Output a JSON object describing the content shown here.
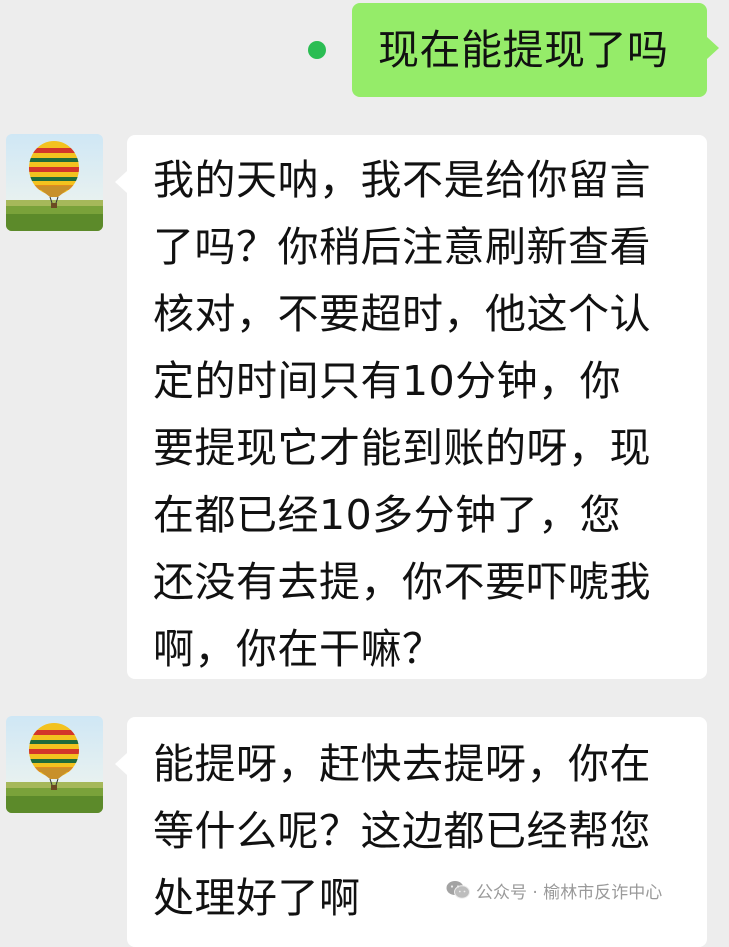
{
  "conversation": {
    "outgoing": {
      "text": "现在能提现了吗",
      "bubble_color": "#95ec69",
      "status_dot_color": "#2bbd53"
    },
    "incoming": [
      {
        "avatar": "hot-air-balloon-avatar",
        "lines": [
          "我的天呐，我不是给你留言",
          "了吗？你稍后注意刷新查看",
          "核对，不要超时，他这个认",
          "定的时间只有10分钟，你",
          "要提现它才能到账的呀，现",
          "在都已经10多分钟了，您",
          "还没有去提，你不要吓唬我",
          "啊，你在干嘛？"
        ]
      },
      {
        "avatar": "hot-air-balloon-avatar",
        "lines": [
          "能提呀，赶快去提呀，你在",
          "等什么呢？这边都已经帮您",
          "处理好了啊"
        ]
      }
    ]
  },
  "watermark": {
    "text": "公众号 · 榆林市反诈中心",
    "icon": "wechat-icon"
  },
  "colors": {
    "background": "#ededed",
    "incoming_bubble": "#ffffff"
  }
}
